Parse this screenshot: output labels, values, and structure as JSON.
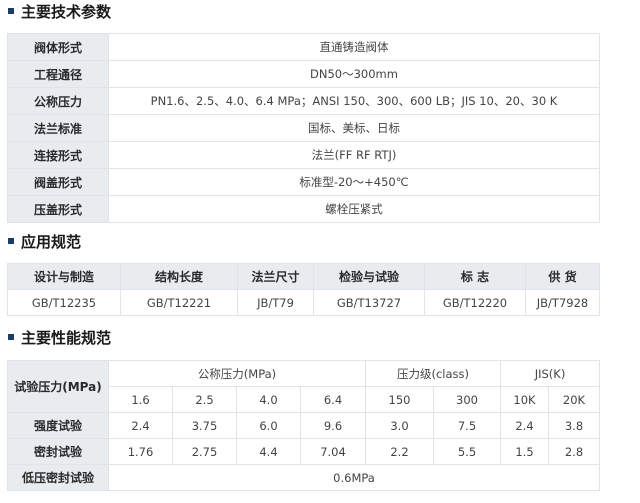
{
  "sections": {
    "specs_title": "主要技术参数",
    "standards_title": "应用规范",
    "performance_title": "主要性能规范"
  },
  "specs": {
    "rows": [
      {
        "label": "阀体形式",
        "value": "直通铸造阀体"
      },
      {
        "label": "工程通径",
        "value": "DN50～300mm"
      },
      {
        "label": "公称压力",
        "value": "PN1.6、2.5、4.0、6.4 MPa；ANSI 150、300、600 LB；JIS 10、20、30 K"
      },
      {
        "label": "法兰标准",
        "value": "国标、美标、日标"
      },
      {
        "label": "连接形式",
        "value": "法兰(FF RF RTJ)"
      },
      {
        "label": "阀盖形式",
        "value": "标准型-20～+450℃"
      },
      {
        "label": "压盖形式",
        "value": "螺栓压紧式"
      }
    ]
  },
  "standards": {
    "headers": [
      "设计与制造",
      "结构长度",
      "法兰尺寸",
      "检验与试验",
      "标 志",
      "供 货"
    ],
    "values": [
      "GB/T12235",
      "GB/T12221",
      "JB/T79",
      "GB/T13727",
      "GB/T12220",
      "JB/T7928"
    ]
  },
  "performance": {
    "row_header": "试验压力(MPa)",
    "group_headers": [
      "公称压力(MPa)",
      "压力级(class)",
      "JIS(K)"
    ],
    "sub_headers": [
      "1.6",
      "2.5",
      "4.0",
      "6.4",
      "150",
      "300",
      "10K",
      "20K"
    ],
    "rows": [
      {
        "label": "强度试验",
        "values": [
          "2.4",
          "3.75",
          "6.0",
          "9.6",
          "3.0",
          "7.5",
          "2.4",
          "3.8"
        ]
      },
      {
        "label": "密封试验",
        "values": [
          "1.76",
          "2.75",
          "4.4",
          "7.04",
          "2.2",
          "5.5",
          "1.5",
          "2.8"
        ]
      }
    ],
    "low_pressure_label": "低压密封试验",
    "low_pressure_value": "0.6MPa"
  }
}
